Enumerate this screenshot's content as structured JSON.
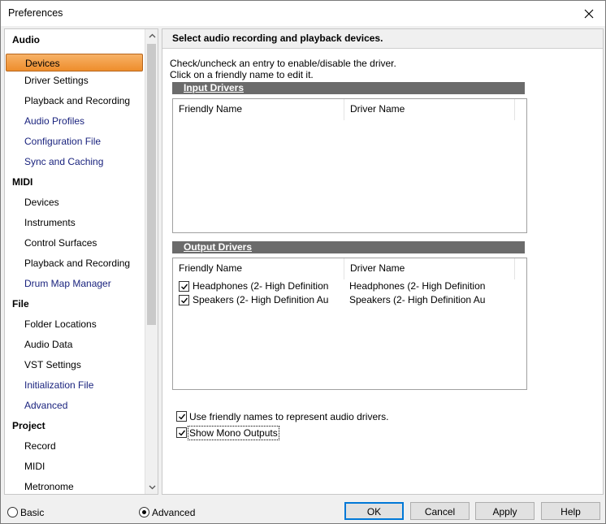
{
  "window": {
    "title": "Preferences"
  },
  "nav": {
    "items": [
      {
        "label": "Audio",
        "kind": "cat"
      },
      {
        "label": "Devices",
        "kind": "sub",
        "selected": true
      },
      {
        "label": "Driver Settings",
        "kind": "sub"
      },
      {
        "label": "Playback and Recording",
        "kind": "sub"
      },
      {
        "label": "Audio Profiles",
        "kind": "sub",
        "link": true
      },
      {
        "label": "Configuration File",
        "kind": "sub",
        "link": true
      },
      {
        "label": "Sync and Caching",
        "kind": "sub",
        "link": true
      },
      {
        "label": "MIDI",
        "kind": "cat"
      },
      {
        "label": "Devices",
        "kind": "sub"
      },
      {
        "label": "Instruments",
        "kind": "sub"
      },
      {
        "label": "Control Surfaces",
        "kind": "sub"
      },
      {
        "label": "Playback and Recording",
        "kind": "sub"
      },
      {
        "label": "Drum Map Manager",
        "kind": "sub",
        "link": true
      },
      {
        "label": "File",
        "kind": "cat"
      },
      {
        "label": "Folder Locations",
        "kind": "sub"
      },
      {
        "label": "Audio Data",
        "kind": "sub"
      },
      {
        "label": "VST Settings",
        "kind": "sub"
      },
      {
        "label": "Initialization File",
        "kind": "sub",
        "link": true
      },
      {
        "label": "Advanced",
        "kind": "sub",
        "link": true
      },
      {
        "label": "Project",
        "kind": "cat"
      },
      {
        "label": "Record",
        "kind": "sub"
      },
      {
        "label": "MIDI",
        "kind": "sub"
      },
      {
        "label": "Metronome",
        "kind": "sub"
      }
    ]
  },
  "panel": {
    "header": "Select audio recording and playback devices.",
    "instructions_line1": "Check/uncheck an entry to enable/disable the driver.",
    "instructions_line2": "Click on a friendly name to edit it.",
    "input_group": {
      "title": "Input Drivers",
      "columns": [
        "Friendly Name",
        "Driver Name"
      ],
      "rows": []
    },
    "output_group": {
      "title": "Output Drivers",
      "columns": [
        "Friendly Name",
        "Driver Name"
      ],
      "rows": [
        {
          "checked": true,
          "friendly": "Headphones (2- High Definition",
          "driver": "Headphones (2- High Definition"
        },
        {
          "checked": true,
          "friendly": "Speakers (2- High Definition Au",
          "driver": "Speakers (2- High Definition Au"
        }
      ]
    },
    "options": {
      "friendly_names": {
        "label": "Use friendly names to represent audio drivers.",
        "checked": true
      },
      "mono_outputs": {
        "label": "Show Mono Outputs",
        "checked": true
      }
    }
  },
  "footer": {
    "basic_label": "Basic",
    "advanced_label": "Advanced",
    "mode_selected": "Advanced",
    "ok_label": "OK",
    "cancel_label": "Cancel",
    "apply_label": "Apply",
    "help_label": "Help"
  }
}
